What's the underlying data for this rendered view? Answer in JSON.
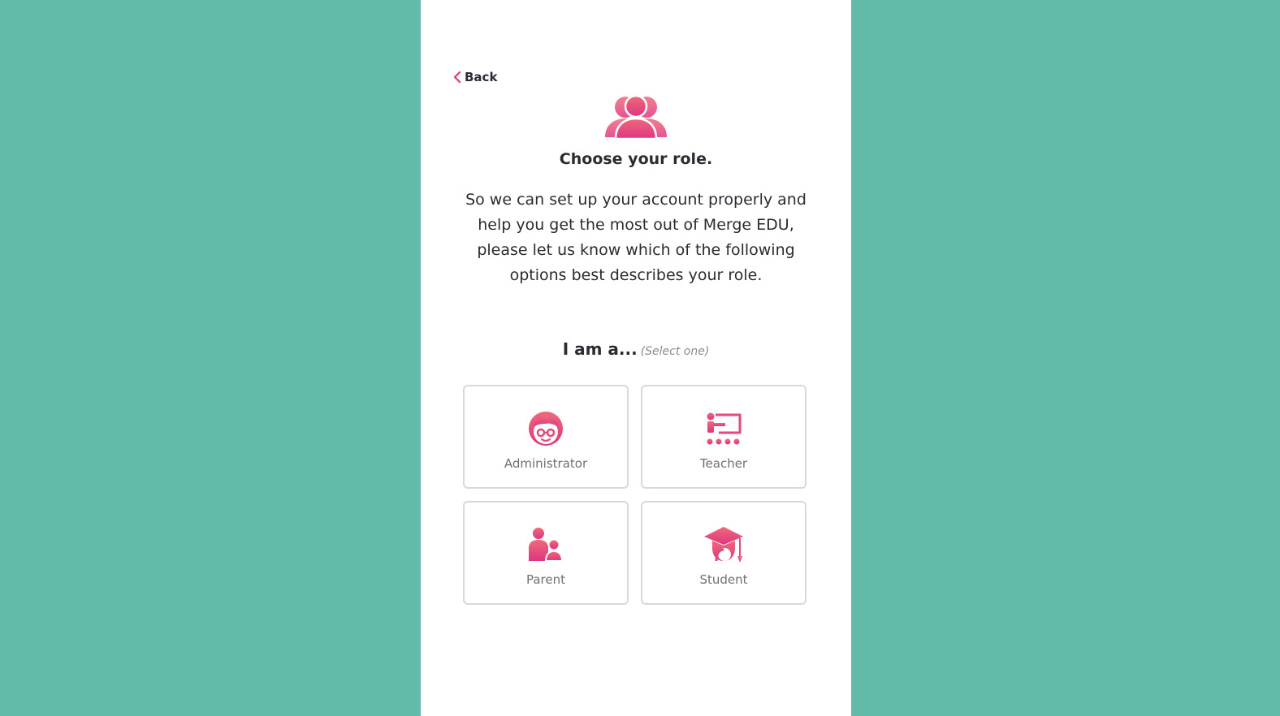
{
  "nav": {
    "back_label": "Back"
  },
  "header": {
    "title": "Choose your role.",
    "description": "So we can set up your account properly and help you get the most out of Merge EDU, please let us know which of the following options best describes your role."
  },
  "role_prompt": {
    "main": "I am a...",
    "hint": "(Select one)"
  },
  "roles": [
    {
      "label": "Administrator",
      "icon": "administrator-icon"
    },
    {
      "label": "Teacher",
      "icon": "teacher-icon"
    },
    {
      "label": "Parent",
      "icon": "parent-icon"
    },
    {
      "label": "Student",
      "icon": "student-icon"
    }
  ],
  "colors": {
    "background": "#62bba9",
    "accent": "#e5497a",
    "card_border": "#d9d9dd",
    "text": "#2b2b33"
  }
}
